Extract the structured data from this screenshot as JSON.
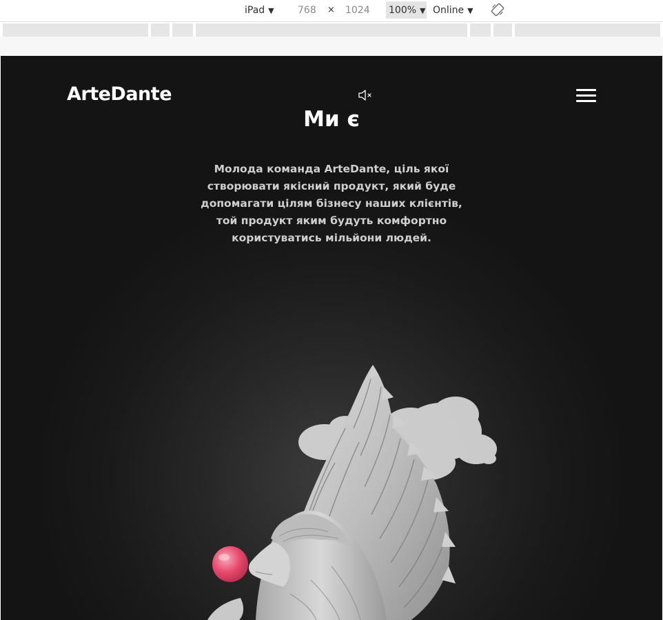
{
  "devtools": {
    "device": "iPad",
    "width": "768",
    "times": "×",
    "height": "1024",
    "zoom": "100%",
    "network": "Online",
    "dropdown_icon": "caret-down-icon",
    "rotate_icon": "rotate-icon"
  },
  "site": {
    "logo": "ArteDante",
    "sound_icon": "speaker-muted-icon",
    "menu_icon": "hamburger-menu-icon",
    "headline": "Ми є",
    "intro_lines": [
      "Молода команда ArteDante, ціль якої",
      "створювати якісний продукт, який буде",
      "допомагати цілям бізнесу наших клієнтів,",
      "той продукт яким будуть комфортно",
      "користуватись мільйони людей."
    ],
    "hero_image": "angel-statue-with-pink-bubble-gum-and-cloud",
    "colors": {
      "background": "#1a1a1a",
      "text": "#ffffff",
      "bubble": "#e84a6c"
    }
  }
}
